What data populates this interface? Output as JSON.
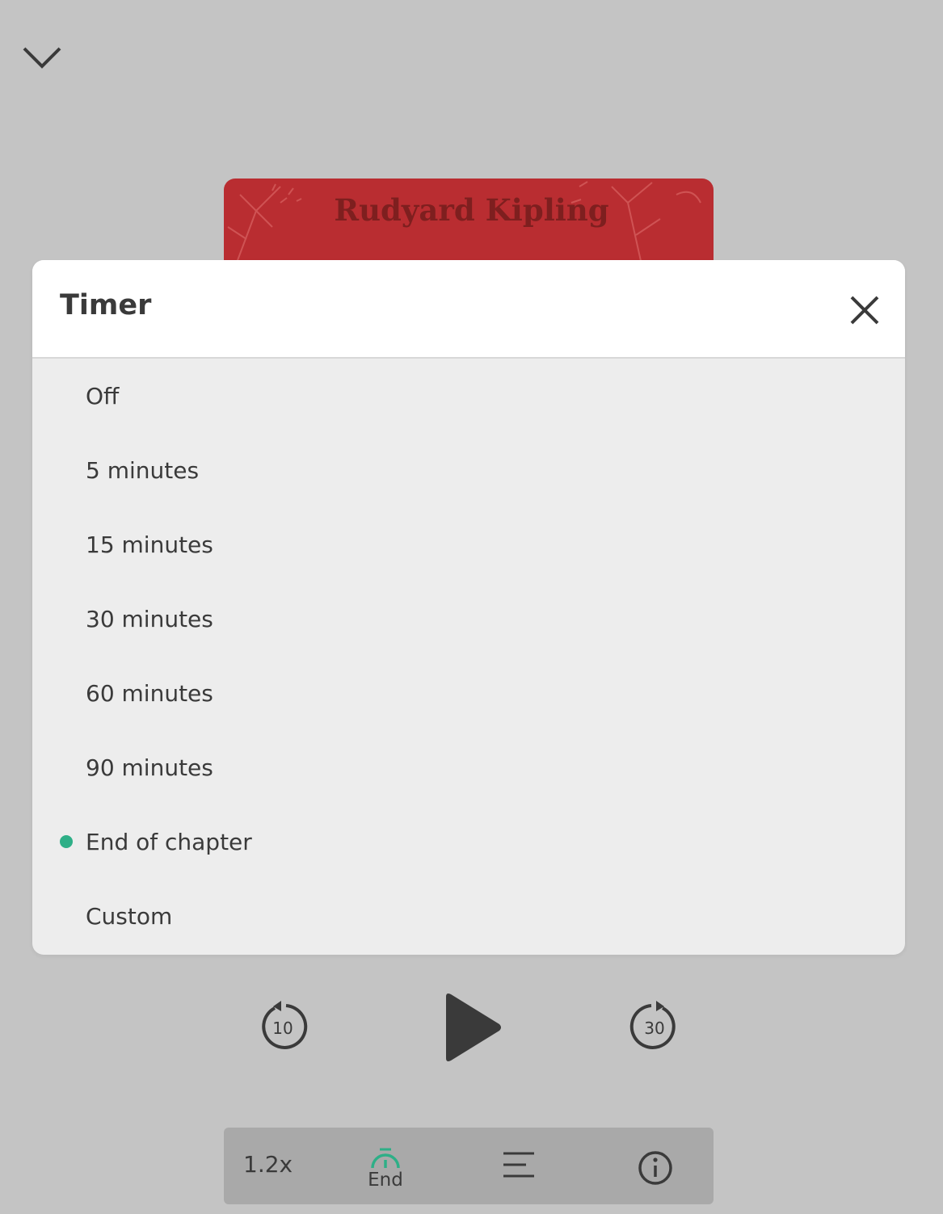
{
  "book": {
    "author": "Rudyard Kipling",
    "cover_color": "#b92d31"
  },
  "timer_dialog": {
    "title": "Timer",
    "options": [
      {
        "label": "Off",
        "selected": false
      },
      {
        "label": "5 minutes",
        "selected": false
      },
      {
        "label": "15 minutes",
        "selected": false
      },
      {
        "label": "30 minutes",
        "selected": false
      },
      {
        "label": "60 minutes",
        "selected": false
      },
      {
        "label": "90 minutes",
        "selected": false
      },
      {
        "label": "End of chapter",
        "selected": true
      },
      {
        "label": "Custom",
        "selected": false
      }
    ],
    "selected_color": "#2eaf87"
  },
  "player": {
    "rewind_label": "10",
    "forward_label": "30"
  },
  "bottom_bar": {
    "speed": "1.2x",
    "timer_label": "End",
    "timer_color": "#2eaf87"
  },
  "icons": [
    "chevron-down-icon",
    "close-icon",
    "rewind-10-icon",
    "play-icon",
    "forward-30-icon",
    "timer-icon",
    "chapters-list-icon",
    "info-icon"
  ]
}
